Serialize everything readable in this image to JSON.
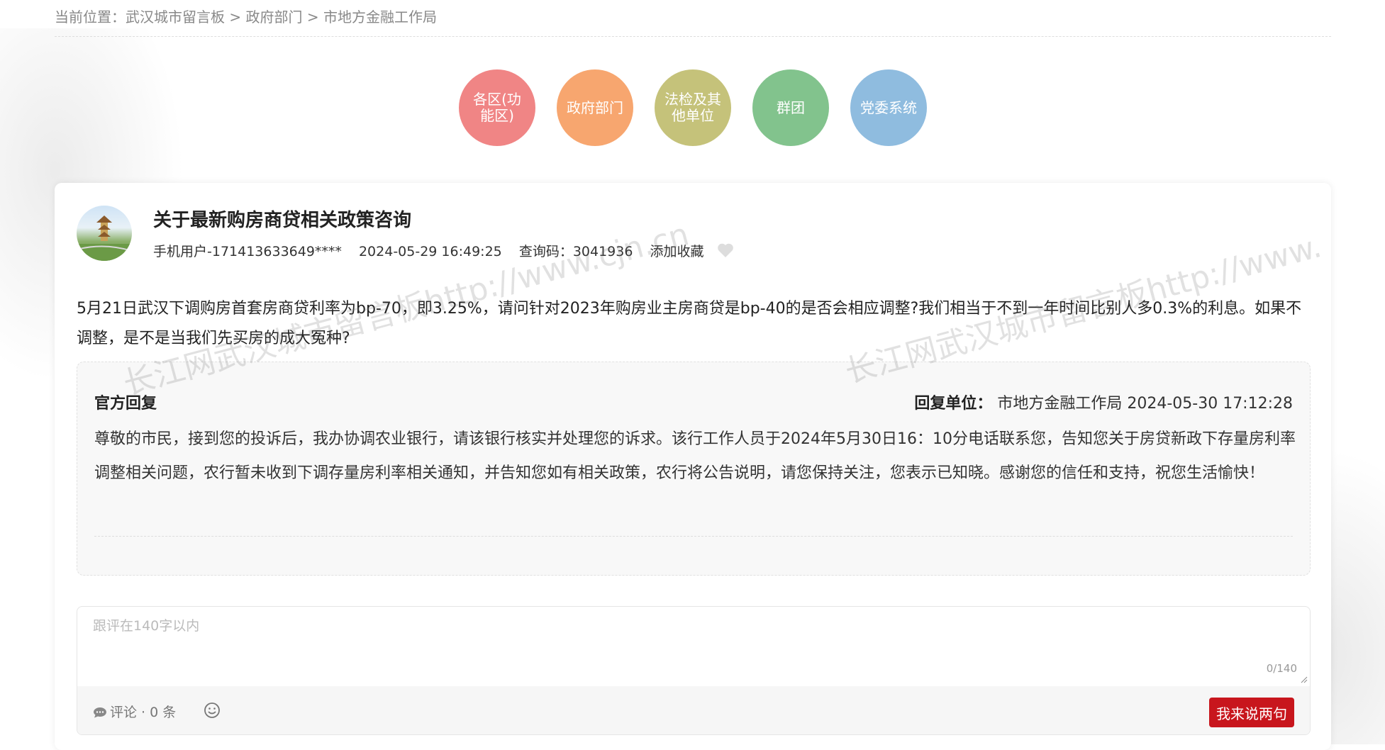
{
  "breadcrumb": {
    "prefix": "当前位置：",
    "items": [
      "武汉城市留言板",
      "政府部门",
      "市地方金融工作局"
    ],
    "separator": " > "
  },
  "categories": [
    {
      "label": "各区(功能区)",
      "color": "#f08585"
    },
    {
      "label": "政府部门",
      "color": "#f7a66f"
    },
    {
      "label": "法检及其他单位",
      "color": "#c5c27a"
    },
    {
      "label": "群团",
      "color": "#82c38d"
    },
    {
      "label": "党委系统",
      "color": "#8fbcdf"
    }
  ],
  "post": {
    "title": "关于最新购房商贷相关政策咨询",
    "user": "手机用户-171413633649****",
    "time": "2024-05-29 16:49:25",
    "query_code": "查询码：3041936",
    "favorite_label": "添加收藏",
    "content": "5月21日武汉下调购房首套房商贷利率为bp-70，即3.25%，请问针对2023年购房业主房商贷是bp-40的是否会相应调整?我们相当于不到一年时间比别人多0.3%的利息。如果不调整，是不是当我们先买房的成大冤种?"
  },
  "reply": {
    "label": "官方回复",
    "unit_label": "回复单位：",
    "unit": "市地方金融工作局",
    "time": "2024-05-30 17:12:28",
    "content": "尊敬的市民，接到您的投诉后，我办协调农业银行，请该银行核实并处理您的诉求。该行工作人员于2024年5月30日16：10分电话联系您，告知您关于房贷新政下存量房利率调整相关问题，农行暂未收到下调存量房利率相关通知，并告知您如有相关政策，农行将公告说明，请您保持关注，您表示已知晓。感谢您的信任和支持，祝您生活愉快！"
  },
  "comment": {
    "placeholder": "跟评在140字以内",
    "counter": "0/140",
    "count_label": "评论 · 0 条",
    "submit": "我来说两句"
  },
  "watermarks": [
    "长江网武汉城市留言板http://www.cjn.cn",
    "长江网武汉城市留言板http://www."
  ],
  "colors": {
    "submit_bg": "#c8161d",
    "reply_bg": "#f8f8f8"
  }
}
